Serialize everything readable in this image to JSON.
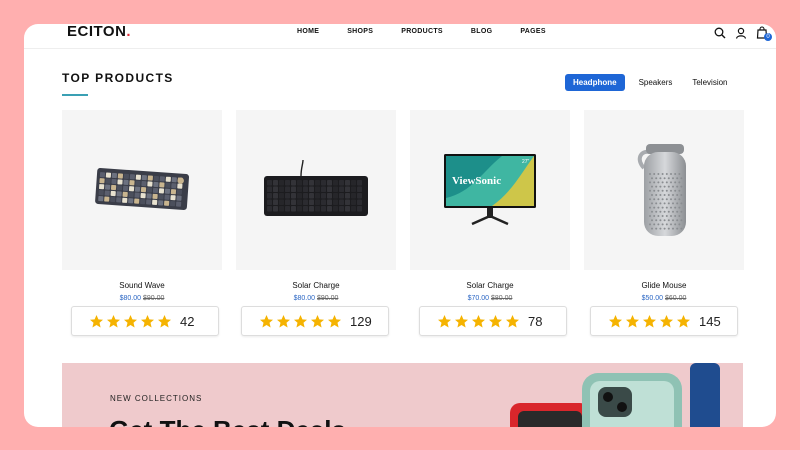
{
  "brand": {
    "name": "ECITON",
    "accent": "#e0303a"
  },
  "nav": {
    "items": [
      "HOME",
      "SHOPS",
      "PRODUCTS",
      "BLOG",
      "PAGES"
    ]
  },
  "header_icons": [
    "search-icon",
    "user-icon",
    "cart-icon"
  ],
  "cart": {
    "count": "0"
  },
  "section": {
    "title": "TOP PRODUCTS",
    "tabs": [
      "Headphone",
      "Speakers",
      "Television"
    ],
    "active_tab": "Headphone"
  },
  "products": [
    {
      "name": "Sound Wave",
      "price": "$80.00",
      "old_price": "$90.00",
      "stars": 5,
      "reviews": "42",
      "image": "keyboard"
    },
    {
      "name": "Solar Charge",
      "price": "$80.00",
      "old_price": "$90.00",
      "stars": 5,
      "reviews": "129",
      "image": "keyboard-black"
    },
    {
      "name": "Solar Charge",
      "price": "$70.00",
      "old_price": "$80.00",
      "stars": 5,
      "reviews": "78",
      "image": "monitor"
    },
    {
      "name": "Glide Mouse",
      "price": "$50.00",
      "old_price": "$60.00",
      "stars": 5,
      "reviews": "145",
      "image": "speaker"
    }
  ],
  "monitor_brand": "ViewSonic",
  "monitor_size": "27\"",
  "promo": {
    "eyebrow": "NEW COLLECTIONS",
    "title": "Get The Best Deals"
  },
  "colors": {
    "primary": "#1e66d6",
    "star": "#f5b301",
    "promo_bg": "#EFCACC",
    "frame_bg": "#FFAFAF"
  }
}
